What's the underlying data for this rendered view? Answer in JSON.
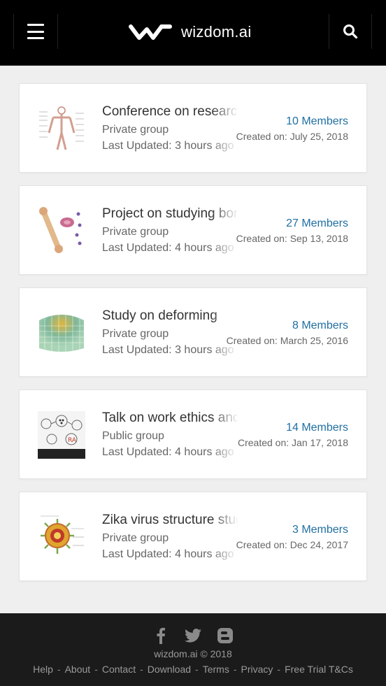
{
  "header": {
    "brand": "wizdom.ai",
    "menu_icon": "hamburger-menu-icon",
    "search_icon": "search-icon"
  },
  "groups": [
    {
      "title": "Conference on research",
      "privacy": "Private group",
      "updated": "Last Updated: 3 hours ago",
      "members": "10 Members",
      "created": "Created on: July 25, 2018",
      "thumb": "anatomy-thumbnail"
    },
    {
      "title": "Project on studying bones",
      "privacy": "Private group",
      "updated": "Last Updated: 4 hours ago",
      "members": "27 Members",
      "created": "Created on: Sep 13, 2018",
      "thumb": "bone-thumbnail"
    },
    {
      "title": "Study on deforming",
      "privacy": "Private group",
      "updated": "Last Updated: 3 hours ago",
      "members": "8 Members",
      "created": "Created on: March 25, 2016",
      "thumb": "mesh-thumbnail"
    },
    {
      "title": "Talk on work ethics and",
      "privacy": "Public group",
      "updated": "Last Updated: 4 hours ago",
      "members": "14 Members",
      "created": "Created on: Jan 17, 2018",
      "thumb": "ethics-diagram-thumbnail"
    },
    {
      "title": "Zika virus structure study",
      "privacy": "Private group",
      "updated": "Last Updated: 4 hours ago",
      "members": "3 Members",
      "created": "Created on: Dec 24, 2017",
      "thumb": "virus-thumbnail"
    }
  ],
  "footer": {
    "social": [
      "facebook-icon",
      "twitter-icon",
      "blogger-icon"
    ],
    "copyright": "wizdom.ai © 2018",
    "links": [
      "Help",
      "About",
      "Contact",
      "Download",
      "Terms",
      "Privacy",
      "Free Trial T&Cs"
    ],
    "separator": "-"
  }
}
